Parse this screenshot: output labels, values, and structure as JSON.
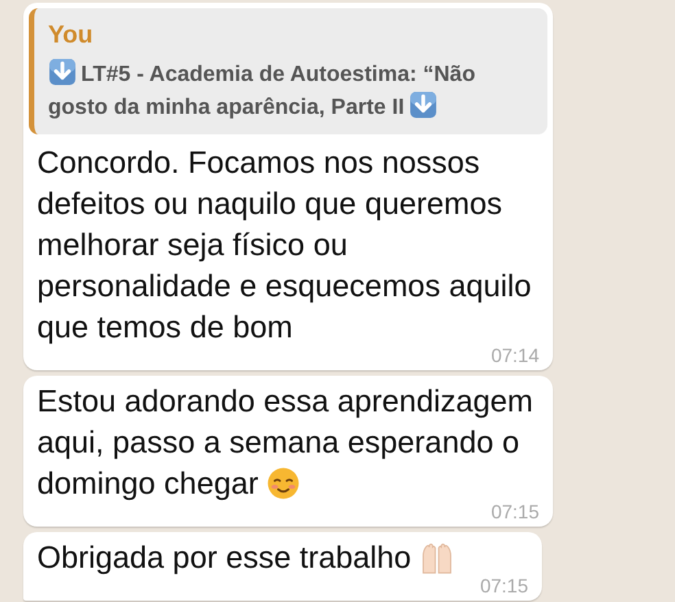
{
  "messages": [
    {
      "quote": {
        "author": "You",
        "text": "LT#5 - Academia de Autoestima: “Não gosto da minha aparência, Parte II",
        "emoji_before": {
          "kind": "arrow"
        },
        "emoji_after": {
          "kind": "arrow"
        }
      },
      "text": "Concordo. Focamos nos nossos defeitos ou naquilo que queremos melhorar seja físico ou personalidade e esquecemos aquilo que temos de bom",
      "time": "07:14"
    },
    {
      "text": "Estou adorando essa aprendizagem aqui, passo a semana esperando o domingo chegar",
      "emoji": {
        "kind": "smile"
      },
      "time": "07:15"
    },
    {
      "text": "Obrigada por esse trabalho",
      "emoji": {
        "kind": "hands"
      },
      "time": "07:15",
      "tail": true
    }
  ]
}
